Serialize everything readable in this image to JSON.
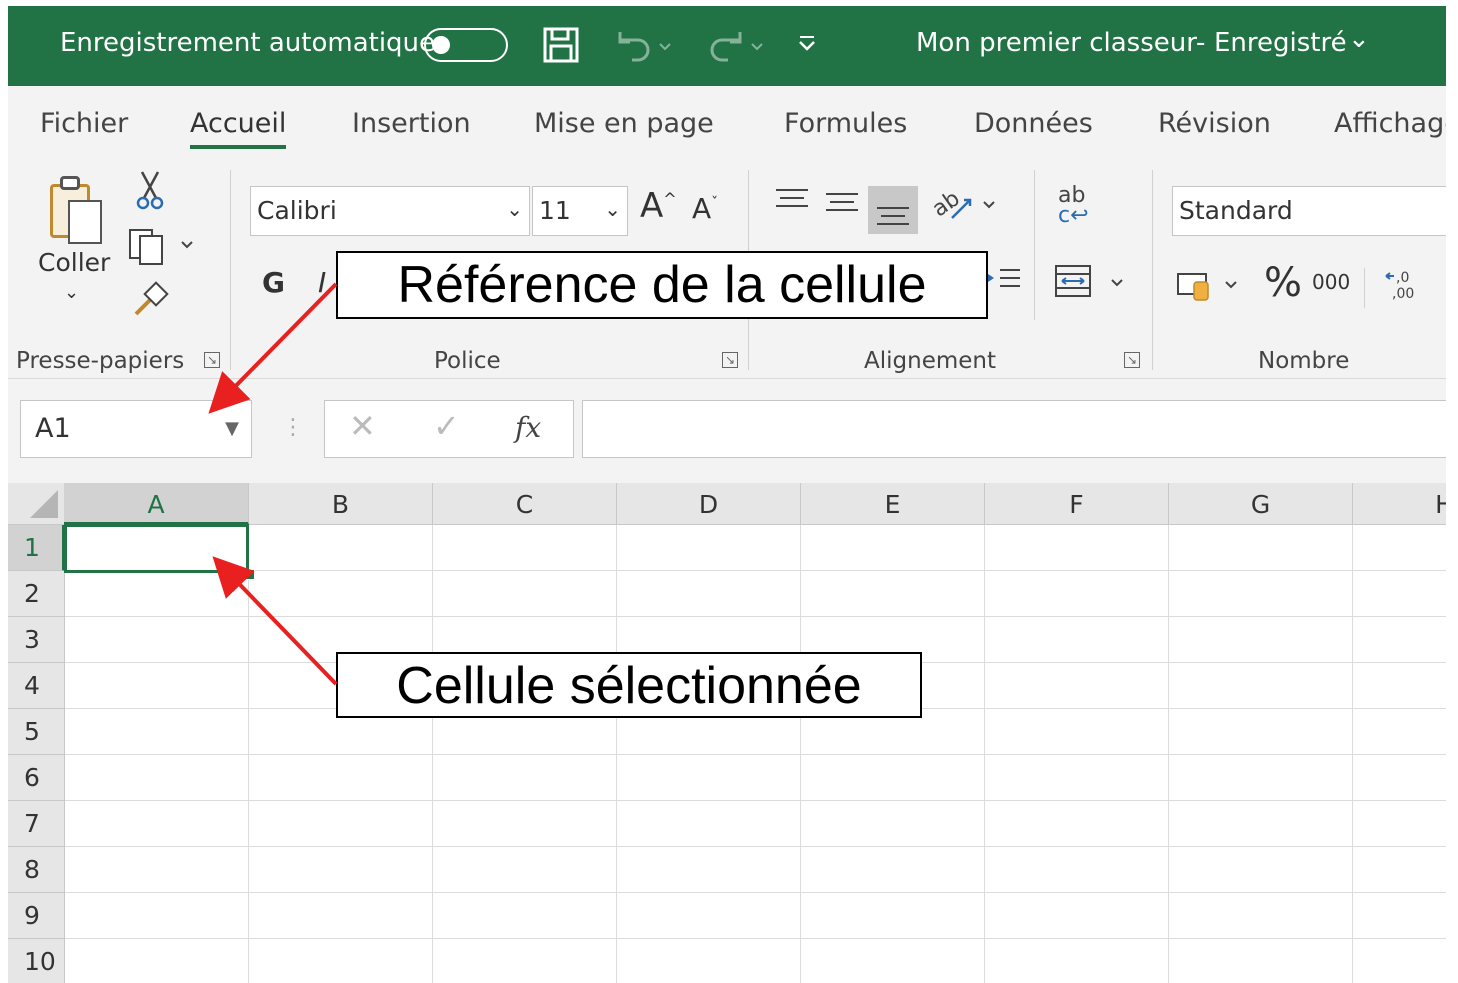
{
  "titlebar": {
    "autosave_label": "Enregistrement automatique",
    "document_title": "Mon premier classeur",
    "separator": "-",
    "status": "Enregistré",
    "status_chevron": "⌄",
    "quick_access": "⌄",
    "icons": [
      "save-icon",
      "undo-icon",
      "redo-icon",
      "customize-quick-access-icon"
    ],
    "accent": "#217346"
  },
  "tabs": [
    "Fichier",
    "Accueil",
    "Insertion",
    "Mise en page",
    "Formules",
    "Données",
    "Révision",
    "Affichage"
  ],
  "ribbon": {
    "clipboard": {
      "paste_label": "Coller",
      "group_label": "Presse-papiers"
    },
    "font": {
      "font_name": "Calibri",
      "font_size": "11",
      "bold": "G",
      "italic": "I",
      "grow": "A",
      "shrink": "A",
      "group_label": "Police"
    },
    "alignment": {
      "wrap": "ab",
      "group_label": "Alignement"
    },
    "number": {
      "format": "Standard",
      "percent": "%",
      "thousands": "000",
      "group_label": "Nombre"
    }
  },
  "formula_bar": {
    "name_box": "A1",
    "fx": "fx",
    "formula": ""
  },
  "grid": {
    "columns": [
      "A",
      "B",
      "C",
      "D",
      "E",
      "F",
      "G",
      "H"
    ],
    "rows": [
      "1",
      "2",
      "3",
      "4",
      "5",
      "6",
      "7",
      "8",
      "9",
      "10"
    ],
    "selected_cell": "A1"
  },
  "annotations": {
    "reference": "Référence de la cellule",
    "selected": "Cellule sélectionnée",
    "arrow_color": "#e8201f"
  }
}
